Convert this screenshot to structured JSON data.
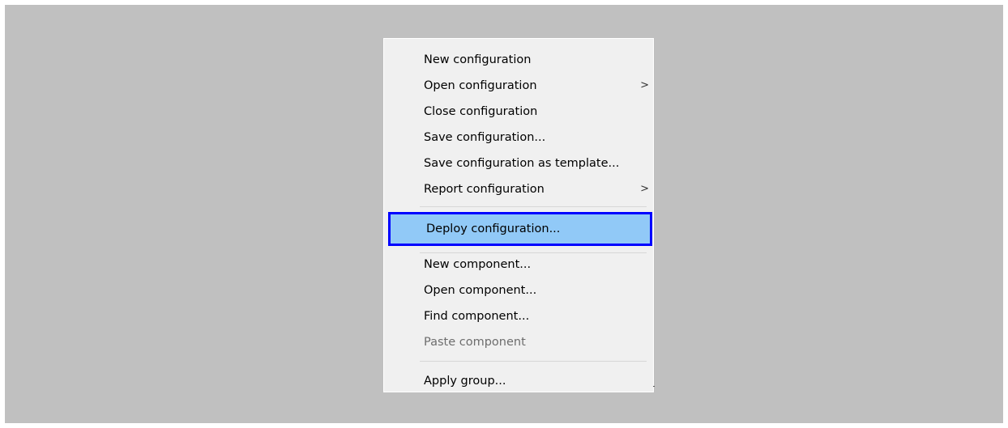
{
  "menu": {
    "items": [
      {
        "label": "New configuration",
        "has_submenu": false,
        "disabled": false,
        "highlighted": false
      },
      {
        "label": "Open configuration",
        "has_submenu": true,
        "disabled": false,
        "highlighted": false
      },
      {
        "label": "Close configuration",
        "has_submenu": false,
        "disabled": false,
        "highlighted": false
      },
      {
        "label": "Save configuration...",
        "has_submenu": false,
        "disabled": false,
        "highlighted": false
      },
      {
        "label": "Save configuration as template...",
        "has_submenu": false,
        "disabled": false,
        "highlighted": false
      },
      {
        "label": "Report configuration",
        "has_submenu": true,
        "disabled": false,
        "highlighted": false
      },
      {
        "label": "Deploy configuration...",
        "has_submenu": false,
        "disabled": false,
        "highlighted": true
      },
      {
        "label": "New component...",
        "has_submenu": false,
        "disabled": false,
        "highlighted": false
      },
      {
        "label": "Open component...",
        "has_submenu": false,
        "disabled": false,
        "highlighted": false
      },
      {
        "label": "Find component...",
        "has_submenu": false,
        "disabled": false,
        "highlighted": false
      },
      {
        "label": "Paste component",
        "has_submenu": false,
        "disabled": true,
        "highlighted": false
      },
      {
        "label": "Apply group...",
        "has_submenu": false,
        "disabled": false,
        "highlighted": false
      }
    ],
    "submenu_arrow": ">"
  },
  "colors": {
    "background": "#c0c0c0",
    "menu_background": "#f0f0f0",
    "highlight_fill": "#91c9f7",
    "highlight_border": "#0000ff",
    "disabled_text": "#6d6d6d"
  }
}
